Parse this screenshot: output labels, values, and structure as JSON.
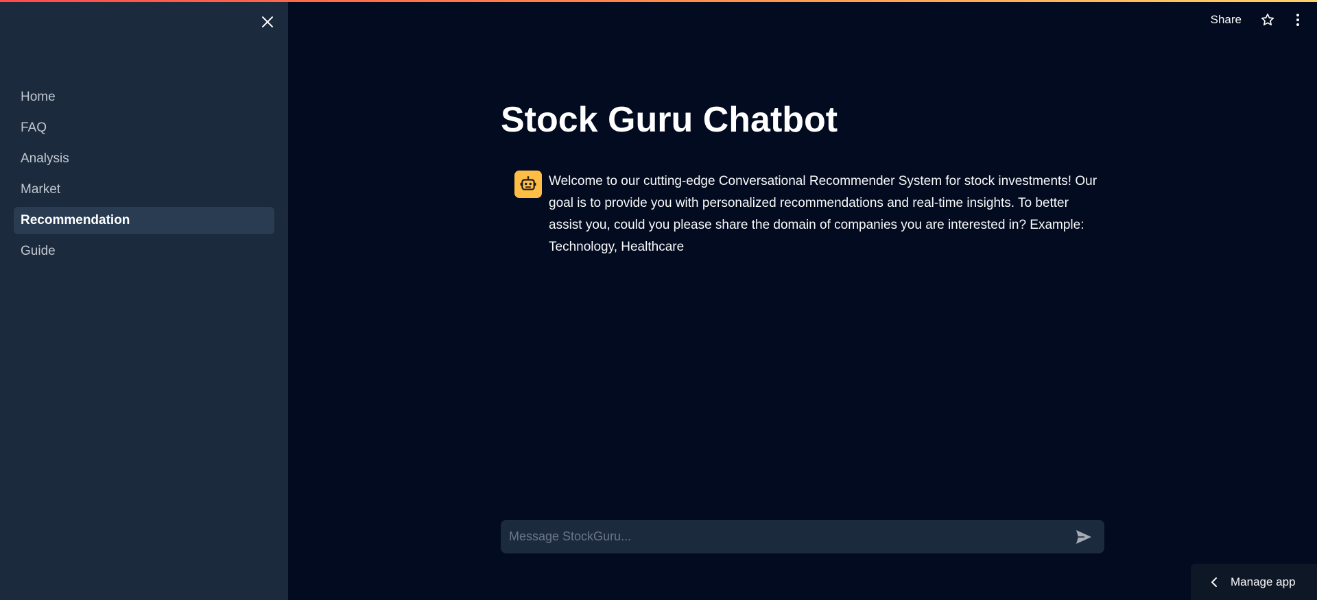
{
  "sidebar": {
    "close_icon": "close-icon",
    "items": [
      {
        "label": "Home",
        "active": false
      },
      {
        "label": "FAQ",
        "active": false
      },
      {
        "label": "Analysis",
        "active": false
      },
      {
        "label": "Market",
        "active": false
      },
      {
        "label": "Recommendation",
        "active": true
      },
      {
        "label": "Guide",
        "active": false
      }
    ]
  },
  "header": {
    "share_label": "Share",
    "star_icon": "star-icon",
    "menu_icon": "more-vertical-icon"
  },
  "main": {
    "title": "Stock Guru Chatbot",
    "messages": [
      {
        "role": "assistant",
        "avatar_icon": "robot-icon",
        "text": "Welcome to our cutting-edge Conversational Recommender System for stock investments! Our goal is to provide you with personalized recommendations and real-time insights. To better assist you, could you please share the domain of companies you are interested in? Example: Technology, Healthcare"
      }
    ]
  },
  "chat_input": {
    "placeholder": "Message StockGuru...",
    "value": "",
    "send_icon": "send-icon"
  },
  "footer": {
    "manage_app_label": "Manage app",
    "chevron_icon": "chevron-left-icon"
  },
  "colors": {
    "background": "#020b1f",
    "sidebar": "#1b2a3c",
    "active_item": "#2a3c52",
    "avatar": "#ffbd45",
    "accent_start": "#ff4b4b",
    "accent_end": "#ffd166"
  }
}
